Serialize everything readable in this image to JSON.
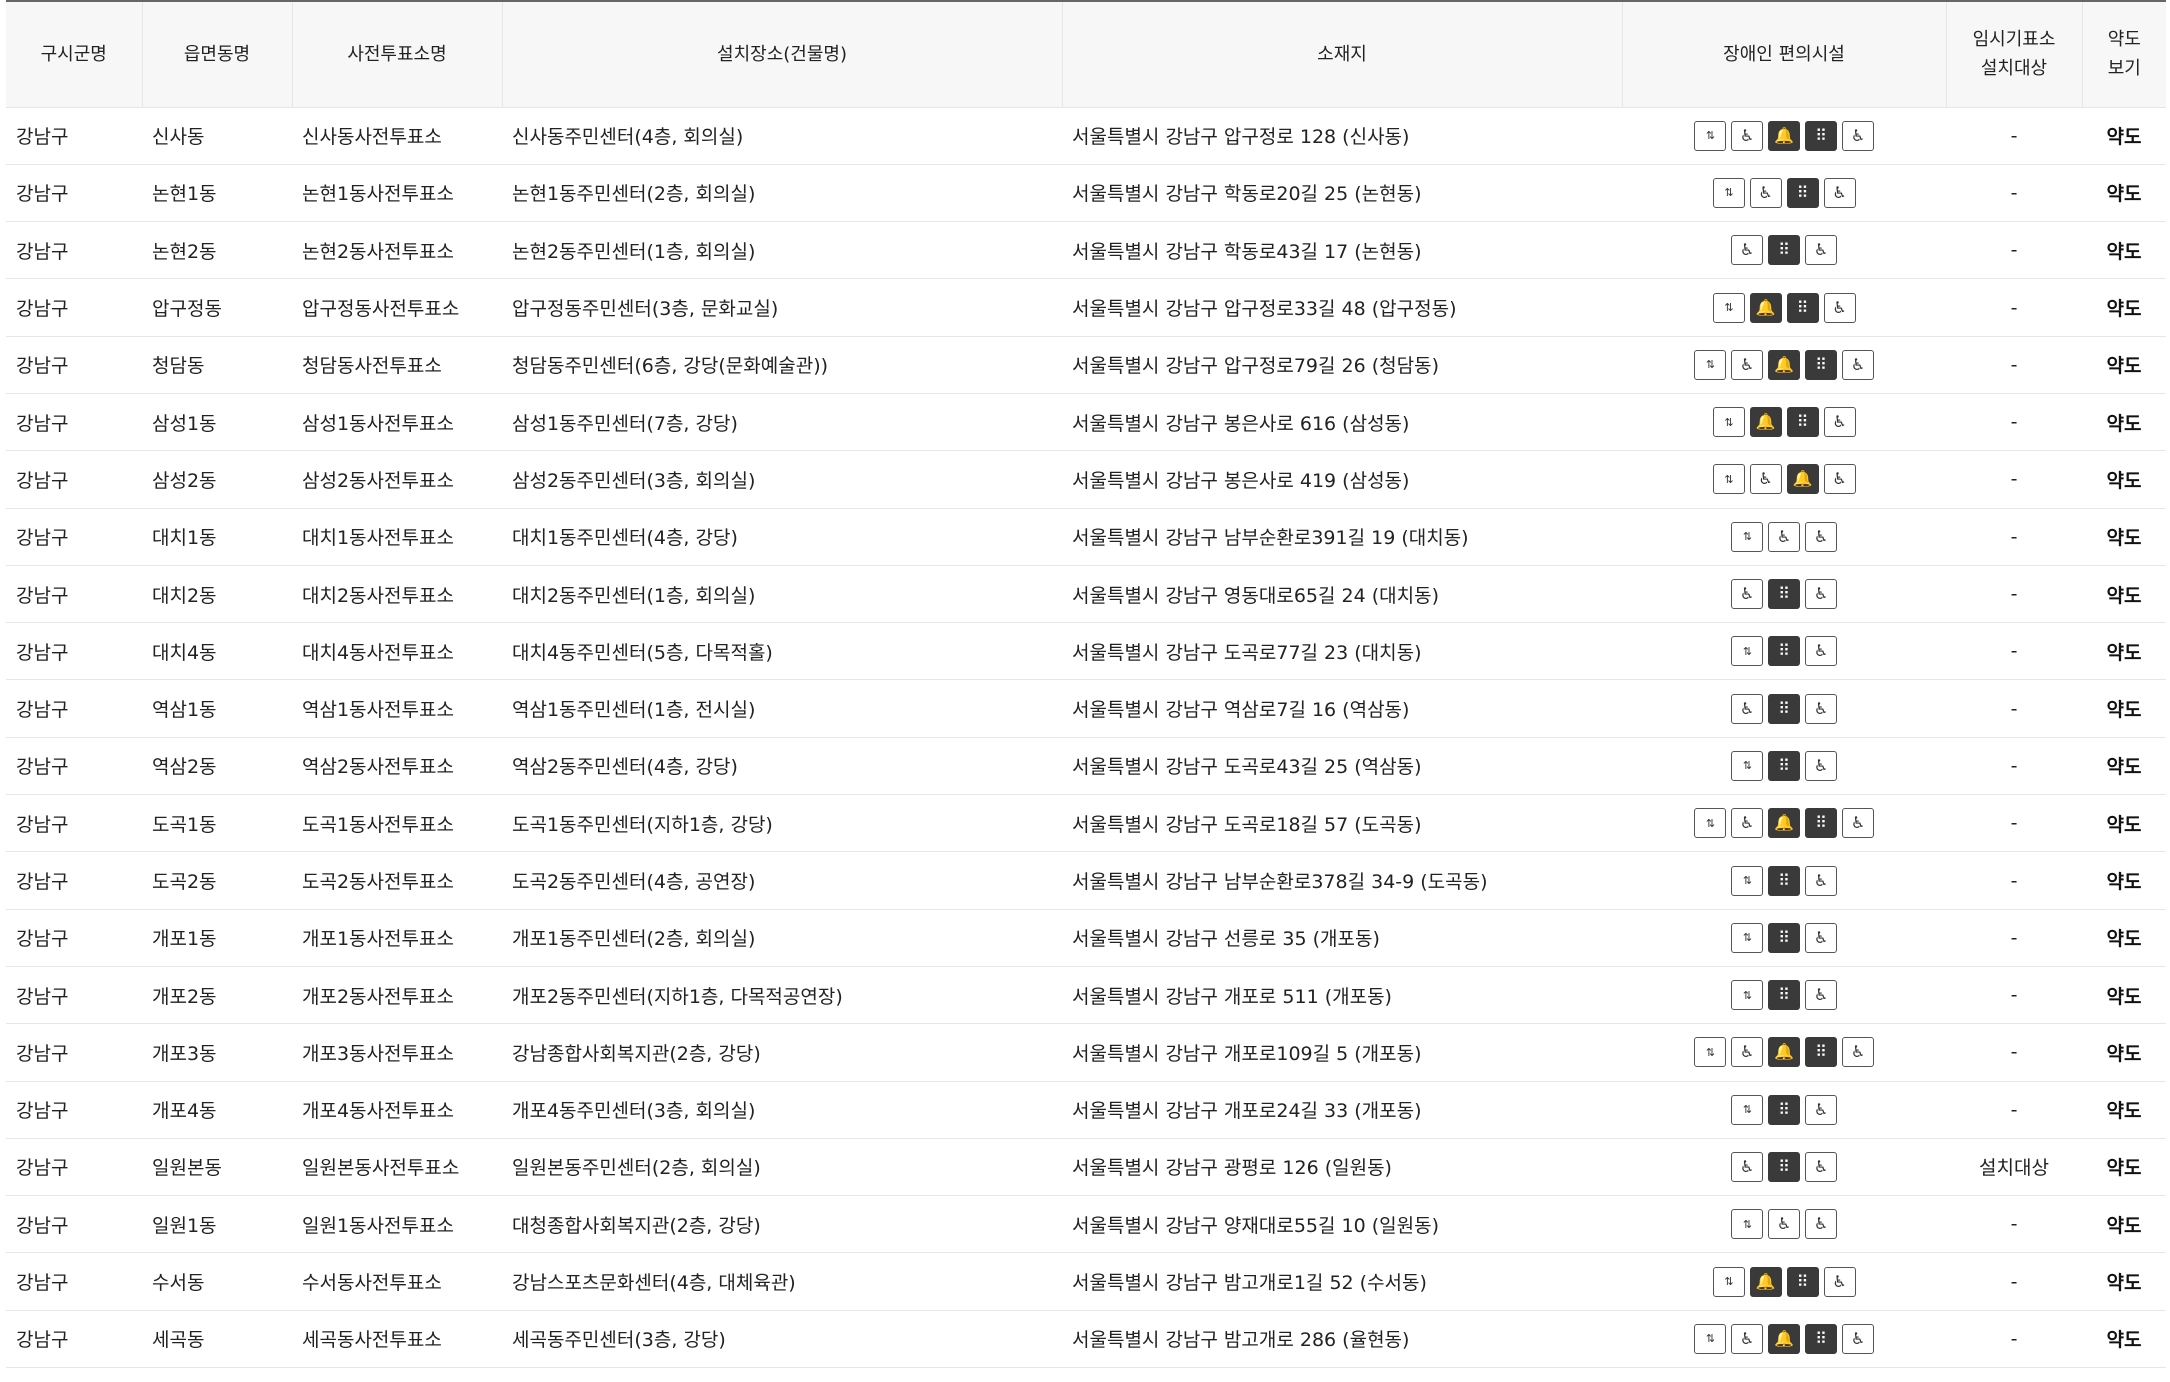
{
  "headers": {
    "sigungu": "구시군명",
    "eupmyeondong": "읍면동명",
    "station": "사전투표소명",
    "place": "설치장소(건물명)",
    "address": "소재지",
    "facilities": "장애인 편의시설",
    "temp_line1": "임시기표소",
    "temp_line2": "설치대상",
    "map_line1": "약도",
    "map_line2": "보기"
  },
  "icon_glyphs": {
    "elevator": "⇅",
    "ramp": "♿",
    "toilet": "♿",
    "bell": "🔔",
    "braille": "⠿",
    "parking": "♿"
  },
  "rows": [
    {
      "sigungu": "강남구",
      "dong": "신사동",
      "station": "신사동사전투표소",
      "place": "신사동주민센터(4층, 회의실)",
      "address": "서울특별시 강남구 압구정로 128 (신사동)",
      "facilities": [
        "elevator",
        "ramp",
        "bell",
        "braille",
        "parking"
      ],
      "temp": "-",
      "map": "약도"
    },
    {
      "sigungu": "강남구",
      "dong": "논현1동",
      "station": "논현1동사전투표소",
      "place": "논현1동주민센터(2층, 회의실)",
      "address": "서울특별시 강남구 학동로20길 25 (논현동)",
      "facilities": [
        "elevator",
        "ramp",
        "braille",
        "parking"
      ],
      "temp": "-",
      "map": "약도"
    },
    {
      "sigungu": "강남구",
      "dong": "논현2동",
      "station": "논현2동사전투표소",
      "place": "논현2동주민센터(1층, 회의실)",
      "address": "서울특별시 강남구 학동로43길 17 (논현동)",
      "facilities": [
        "ramp",
        "braille",
        "parking"
      ],
      "temp": "-",
      "map": "약도"
    },
    {
      "sigungu": "강남구",
      "dong": "압구정동",
      "station": "압구정동사전투표소",
      "place": "압구정동주민센터(3층, 문화교실)",
      "address": "서울특별시 강남구 압구정로33길 48 (압구정동)",
      "facilities": [
        "elevator",
        "bell",
        "braille",
        "parking"
      ],
      "temp": "-",
      "map": "약도"
    },
    {
      "sigungu": "강남구",
      "dong": "청담동",
      "station": "청담동사전투표소",
      "place": "청담동주민센터(6층, 강당(문화예술관))",
      "address": "서울특별시 강남구 압구정로79길 26 (청담동)",
      "facilities": [
        "elevator",
        "ramp",
        "bell",
        "braille",
        "parking"
      ],
      "temp": "-",
      "map": "약도"
    },
    {
      "sigungu": "강남구",
      "dong": "삼성1동",
      "station": "삼성1동사전투표소",
      "place": "삼성1동주민센터(7층, 강당)",
      "address": "서울특별시 강남구 봉은사로 616 (삼성동)",
      "facilities": [
        "elevator",
        "bell",
        "braille",
        "parking"
      ],
      "temp": "-",
      "map": "약도"
    },
    {
      "sigungu": "강남구",
      "dong": "삼성2동",
      "station": "삼성2동사전투표소",
      "place": "삼성2동주민센터(3층, 회의실)",
      "address": "서울특별시 강남구 봉은사로 419 (삼성동)",
      "facilities": [
        "elevator",
        "ramp",
        "bell",
        "parking"
      ],
      "temp": "-",
      "map": "약도"
    },
    {
      "sigungu": "강남구",
      "dong": "대치1동",
      "station": "대치1동사전투표소",
      "place": "대치1동주민센터(4층, 강당)",
      "address": "서울특별시 강남구 남부순환로391길 19 (대치동)",
      "facilities": [
        "elevator",
        "ramp",
        "parking"
      ],
      "temp": "-",
      "map": "약도"
    },
    {
      "sigungu": "강남구",
      "dong": "대치2동",
      "station": "대치2동사전투표소",
      "place": "대치2동주민센터(1층, 회의실)",
      "address": "서울특별시 강남구 영동대로65길 24 (대치동)",
      "facilities": [
        "ramp",
        "braille",
        "parking"
      ],
      "temp": "-",
      "map": "약도"
    },
    {
      "sigungu": "강남구",
      "dong": "대치4동",
      "station": "대치4동사전투표소",
      "place": "대치4동주민센터(5층, 다목적홀)",
      "address": "서울특별시 강남구 도곡로77길 23 (대치동)",
      "facilities": [
        "elevator",
        "braille",
        "parking"
      ],
      "temp": "-",
      "map": "약도"
    },
    {
      "sigungu": "강남구",
      "dong": "역삼1동",
      "station": "역삼1동사전투표소",
      "place": "역삼1동주민센터(1층, 전시실)",
      "address": "서울특별시 강남구 역삼로7길 16 (역삼동)",
      "facilities": [
        "ramp",
        "braille",
        "parking"
      ],
      "temp": "-",
      "map": "약도"
    },
    {
      "sigungu": "강남구",
      "dong": "역삼2동",
      "station": "역삼2동사전투표소",
      "place": "역삼2동주민센터(4층, 강당)",
      "address": "서울특별시 강남구 도곡로43길 25 (역삼동)",
      "facilities": [
        "elevator",
        "braille",
        "parking"
      ],
      "temp": "-",
      "map": "약도"
    },
    {
      "sigungu": "강남구",
      "dong": "도곡1동",
      "station": "도곡1동사전투표소",
      "place": "도곡1동주민센터(지하1층, 강당)",
      "address": "서울특별시 강남구 도곡로18길 57 (도곡동)",
      "facilities": [
        "elevator",
        "ramp",
        "bell",
        "braille",
        "parking"
      ],
      "temp": "-",
      "map": "약도"
    },
    {
      "sigungu": "강남구",
      "dong": "도곡2동",
      "station": "도곡2동사전투표소",
      "place": "도곡2동주민센터(4층, 공연장)",
      "address": "서울특별시 강남구 남부순환로378길 34-9 (도곡동)",
      "facilities": [
        "elevator",
        "braille",
        "parking"
      ],
      "temp": "-",
      "map": "약도"
    },
    {
      "sigungu": "강남구",
      "dong": "개포1동",
      "station": "개포1동사전투표소",
      "place": "개포1동주민센터(2층, 회의실)",
      "address": "서울특별시 강남구 선릉로 35 (개포동)",
      "facilities": [
        "elevator",
        "braille",
        "parking"
      ],
      "temp": "-",
      "map": "약도"
    },
    {
      "sigungu": "강남구",
      "dong": "개포2동",
      "station": "개포2동사전투표소",
      "place": "개포2동주민센터(지하1층, 다목적공연장)",
      "address": "서울특별시 강남구 개포로 511 (개포동)",
      "facilities": [
        "elevator",
        "braille",
        "parking"
      ],
      "temp": "-",
      "map": "약도"
    },
    {
      "sigungu": "강남구",
      "dong": "개포3동",
      "station": "개포3동사전투표소",
      "place": "강남종합사회복지관(2층, 강당)",
      "address": "서울특별시 강남구 개포로109길 5 (개포동)",
      "facilities": [
        "elevator",
        "ramp",
        "bell",
        "braille",
        "parking"
      ],
      "temp": "-",
      "map": "약도"
    },
    {
      "sigungu": "강남구",
      "dong": "개포4동",
      "station": "개포4동사전투표소",
      "place": "개포4동주민센터(3층, 회의실)",
      "address": "서울특별시 강남구 개포로24길 33 (개포동)",
      "facilities": [
        "elevator",
        "braille",
        "parking"
      ],
      "temp": "-",
      "map": "약도"
    },
    {
      "sigungu": "강남구",
      "dong": "일원본동",
      "station": "일원본동사전투표소",
      "place": "일원본동주민센터(2층, 회의실)",
      "address": "서울특별시 강남구 광평로 126 (일원동)",
      "facilities": [
        "ramp",
        "braille",
        "parking"
      ],
      "temp": "설치대상",
      "map": "약도"
    },
    {
      "sigungu": "강남구",
      "dong": "일원1동",
      "station": "일원1동사전투표소",
      "place": "대청종합사회복지관(2층, 강당)",
      "address": "서울특별시 강남구 양재대로55길 10 (일원동)",
      "facilities": [
        "elevator",
        "ramp",
        "parking"
      ],
      "temp": "-",
      "map": "약도"
    },
    {
      "sigungu": "강남구",
      "dong": "수서동",
      "station": "수서동사전투표소",
      "place": "강남스포츠문화센터(4층, 대체육관)",
      "address": "서울특별시 강남구 밤고개로1길 52 (수서동)",
      "facilities": [
        "elevator",
        "bell",
        "braille",
        "parking"
      ],
      "temp": "-",
      "map": "약도"
    },
    {
      "sigungu": "강남구",
      "dong": "세곡동",
      "station": "세곡동사전투표소",
      "place": "세곡동주민센터(3층, 강당)",
      "address": "서울특별시 강남구 밤고개로 286 (율현동)",
      "facilities": [
        "elevator",
        "ramp",
        "bell",
        "braille",
        "parking"
      ],
      "temp": "-",
      "map": "약도"
    }
  ]
}
